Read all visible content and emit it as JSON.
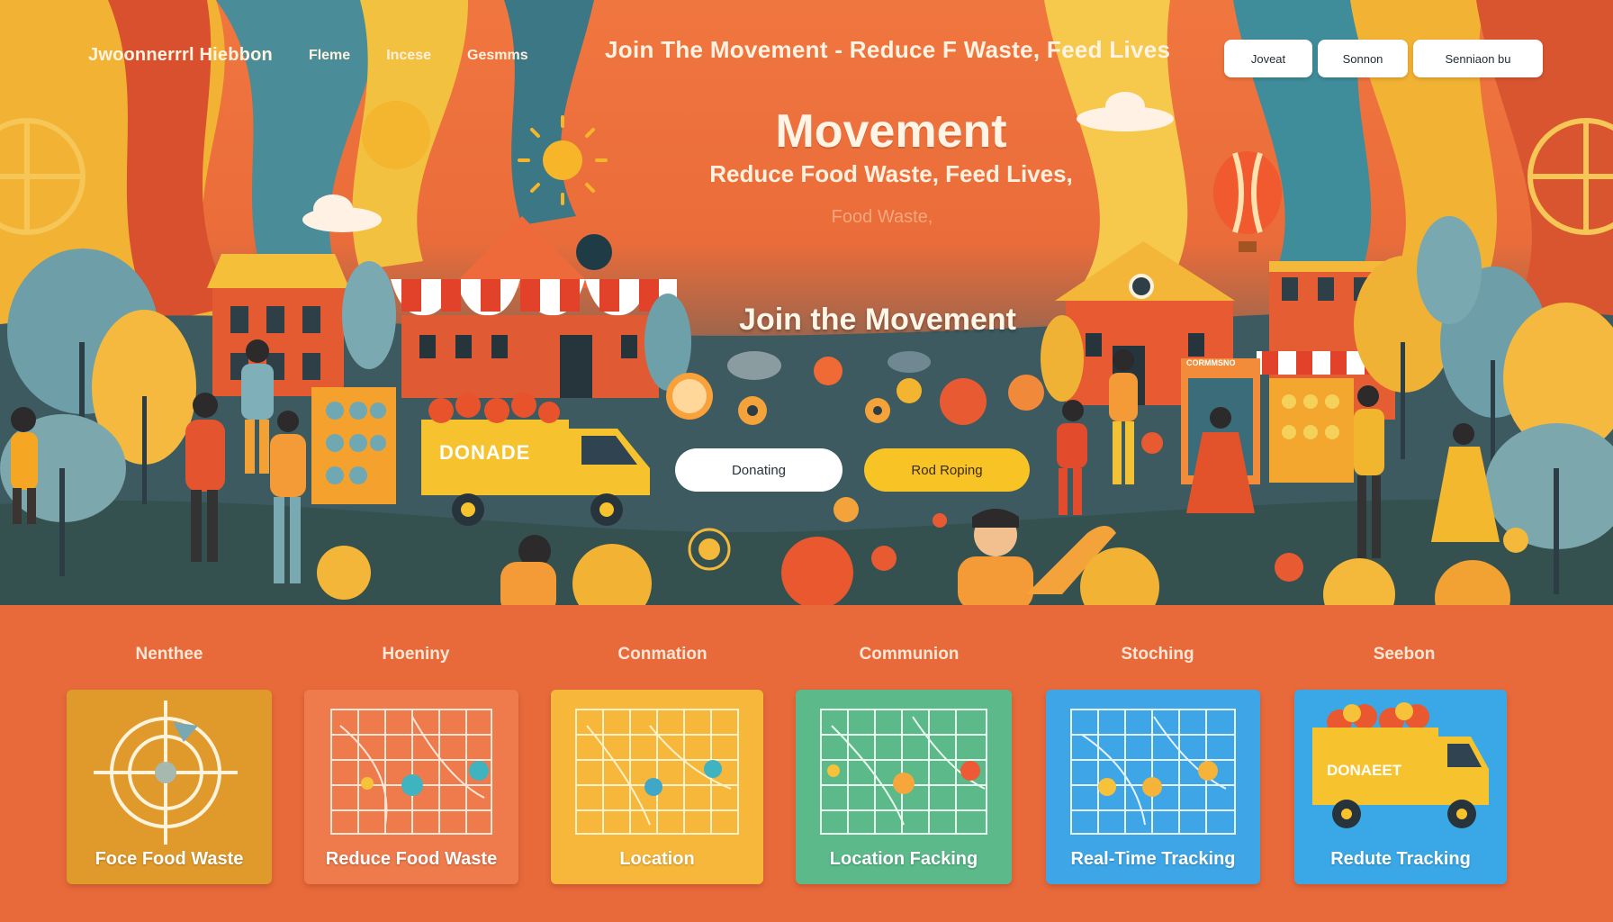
{
  "header": {
    "brand": "Jwoonnerrrl Hiebbon",
    "nav": [
      "Fleme",
      "Incese",
      "Gesmms"
    ],
    "banner": "Join The Movement - Reduce F  Waste, Feed Lives",
    "buttons": [
      "Joveat",
      "Sonnon",
      "Senniaon  bu"
    ]
  },
  "hero": {
    "heading": "Movement",
    "subheading": "Reduce Food Waste, Feed Lives,",
    "faint": "Food Waste,",
    "cta_title": "Join the Movement",
    "cta_primary": "Donating",
    "cta_secondary": "Rod Roping",
    "truck_label": "DONADE",
    "shop_label": "CORMMSNO"
  },
  "features": {
    "labels": [
      "Nenthee",
      "Hoeniny",
      "Conmation",
      "Communion",
      "Stoching",
      "Seebon"
    ],
    "cards": [
      {
        "title": "Foce Food Waste",
        "color": "#e09a2c",
        "icon": "target-icon"
      },
      {
        "title": "Reduce Food Waste",
        "color": "#ef7a4c",
        "icon": "map-grid-icon"
      },
      {
        "title": "Location",
        "color": "#f6b73a",
        "icon": "map-grid-icon"
      },
      {
        "title": "Location Facking",
        "color": "#5bb98a",
        "icon": "map-grid-icon"
      },
      {
        "title": "Real-Time Tracking",
        "color": "#3ea6e6",
        "icon": "map-grid-icon"
      },
      {
        "title": "Redute Tracking",
        "color": "#3aa8e6",
        "icon": "truck-icon",
        "truck_label": "DONAEET"
      }
    ]
  }
}
